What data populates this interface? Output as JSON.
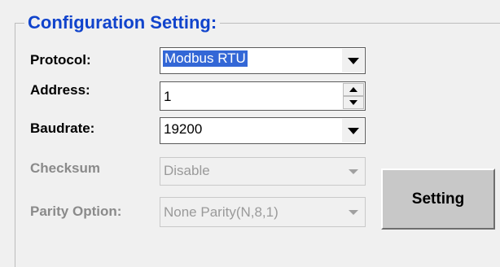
{
  "group": {
    "title": "Configuration Setting:"
  },
  "protocol": {
    "label": "Protocol:",
    "value": "Modbus RTU"
  },
  "address": {
    "label": "Address:",
    "value": "1"
  },
  "baudrate": {
    "label": "Baudrate:",
    "value": "19200"
  },
  "checksum": {
    "label": "Checksum",
    "value": "Disable"
  },
  "parity": {
    "label": "Parity Option:",
    "value": "None Parity(N,8,1)"
  },
  "setting_button": {
    "label": "Setting"
  },
  "colors": {
    "title": "#1144cc",
    "disabled_text": "#8a8a8a",
    "selection": "#3367d6",
    "background": "#f0f0f0"
  },
  "icons": {
    "dropdown": "chevron-down-icon",
    "spin_up": "arrow-up-icon",
    "spin_down": "arrow-down-icon"
  }
}
